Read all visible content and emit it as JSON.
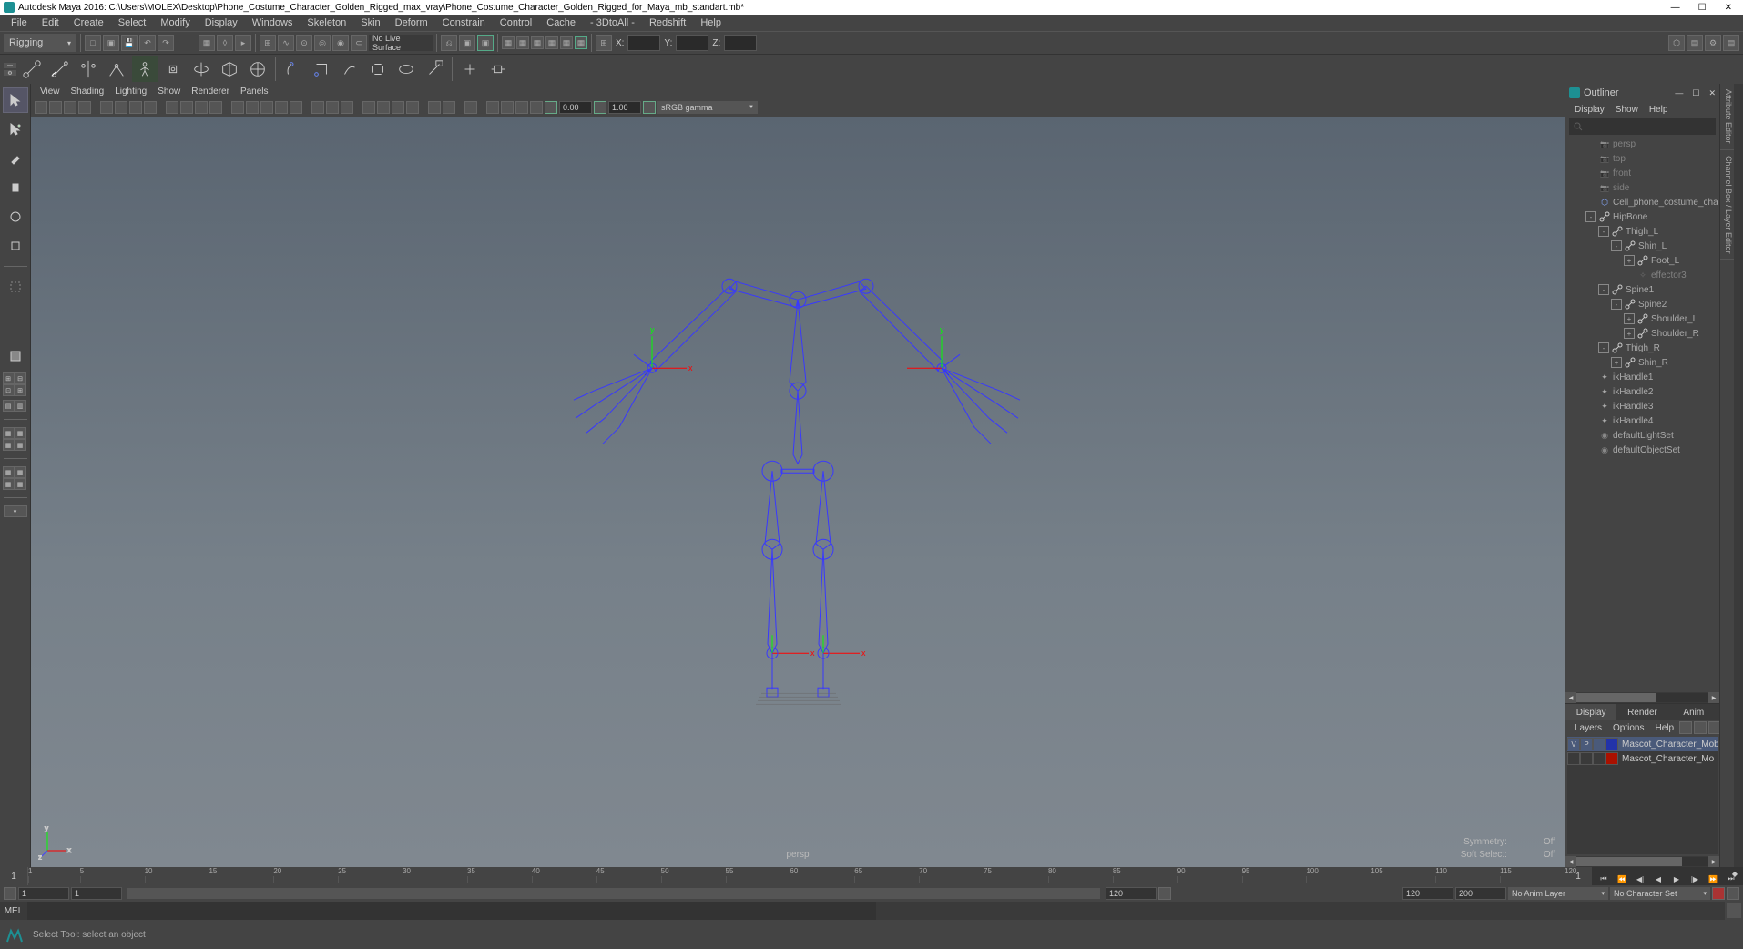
{
  "title": "Autodesk Maya 2016: C:\\Users\\MOLEX\\Desktop\\Phone_Costume_Character_Golden_Rigged_max_vray\\Phone_Costume_Character_Golden_Rigged_for_Maya_mb_standart.mb*",
  "menubar": [
    "File",
    "Edit",
    "Create",
    "Select",
    "Modify",
    "Display",
    "Windows",
    "Skeleton",
    "Skin",
    "Deform",
    "Constrain",
    "Control",
    "Cache",
    "- 3DtoAll -",
    "Redshift",
    "Help"
  ],
  "shelf": {
    "mode": "Rigging",
    "surface": "No Live Surface",
    "x": "X:",
    "y": "Y:",
    "z": "Z:"
  },
  "vp_menu": [
    "View",
    "Shading",
    "Lighting",
    "Show",
    "Renderer",
    "Panels"
  ],
  "vp": {
    "near": "0.00",
    "far": "1.00",
    "gamma": "sRGB gamma",
    "camera": "persp",
    "sym_l": "Symmetry:",
    "sym_v": "Off",
    "ss_l": "Soft Select:",
    "ss_v": "Off"
  },
  "gizmo": {
    "x": "x",
    "y": "y",
    "z": "z"
  },
  "outliner": {
    "title": "Outliner",
    "menu": [
      "Display",
      "Show",
      "Help"
    ],
    "items": [
      {
        "d": 0,
        "t": "cam",
        "n": "persp",
        "dim": true
      },
      {
        "d": 0,
        "t": "cam",
        "n": "top",
        "dim": true
      },
      {
        "d": 0,
        "t": "cam",
        "n": "front",
        "dim": true
      },
      {
        "d": 0,
        "t": "cam",
        "n": "side",
        "dim": true
      },
      {
        "d": 0,
        "t": "mesh",
        "n": "Cell_phone_costume_cha"
      },
      {
        "d": 0,
        "t": "joint",
        "n": "HipBone",
        "e": "-"
      },
      {
        "d": 1,
        "t": "joint",
        "n": "Thigh_L",
        "e": "-"
      },
      {
        "d": 2,
        "t": "joint",
        "n": "Shin_L",
        "e": "-"
      },
      {
        "d": 3,
        "t": "joint",
        "n": "Foot_L",
        "e": "+"
      },
      {
        "d": 3,
        "t": "eff",
        "n": "effector3",
        "dim": true
      },
      {
        "d": 1,
        "t": "joint",
        "n": "Spine1",
        "e": "-"
      },
      {
        "d": 2,
        "t": "joint",
        "n": "Spine2",
        "e": "-"
      },
      {
        "d": 3,
        "t": "joint",
        "n": "Shoulder_L",
        "e": "+"
      },
      {
        "d": 3,
        "t": "joint",
        "n": "Shoulder_R",
        "e": "+"
      },
      {
        "d": 1,
        "t": "joint",
        "n": "Thigh_R",
        "e": "-"
      },
      {
        "d": 2,
        "t": "joint",
        "n": "Shin_R",
        "e": "+"
      },
      {
        "d": 0,
        "t": "ik",
        "n": "ikHandle1"
      },
      {
        "d": 0,
        "t": "ik",
        "n": "ikHandle2"
      },
      {
        "d": 0,
        "t": "ik",
        "n": "ikHandle3"
      },
      {
        "d": 0,
        "t": "ik",
        "n": "ikHandle4"
      },
      {
        "d": 0,
        "t": "set",
        "n": "defaultLightSet"
      },
      {
        "d": 0,
        "t": "set",
        "n": "defaultObjectSet"
      }
    ]
  },
  "layers": {
    "tabs": [
      "Display",
      "Render",
      "Anim"
    ],
    "menu": [
      "Layers",
      "Options",
      "Help"
    ],
    "rows": [
      {
        "v": "V",
        "p": "P",
        "c": "#2233aa",
        "n": "Mascot_Character_Mobile_P",
        "sel": true
      },
      {
        "v": "",
        "p": "",
        "c": "#aa1100",
        "n": "Mascot_Character_Mo",
        "sel": false
      }
    ]
  },
  "rtabs": [
    "Attribute Editor",
    "Channel Box / Layer Editor"
  ],
  "timeline": {
    "current": "1",
    "ticks": [
      1,
      5,
      10,
      15,
      20,
      25,
      30,
      35,
      40,
      45,
      50,
      55,
      60,
      65,
      70,
      75,
      80,
      85,
      90,
      95,
      100,
      105,
      110,
      115,
      120
    ]
  },
  "range": {
    "s1": "1",
    "s2": "1",
    "e1": "120",
    "e2": "120",
    "e3": "200",
    "anim": "No Anim Layer",
    "char": "No Character Set"
  },
  "cmd": {
    "lang": "MEL"
  },
  "status": "Select Tool: select an object"
}
